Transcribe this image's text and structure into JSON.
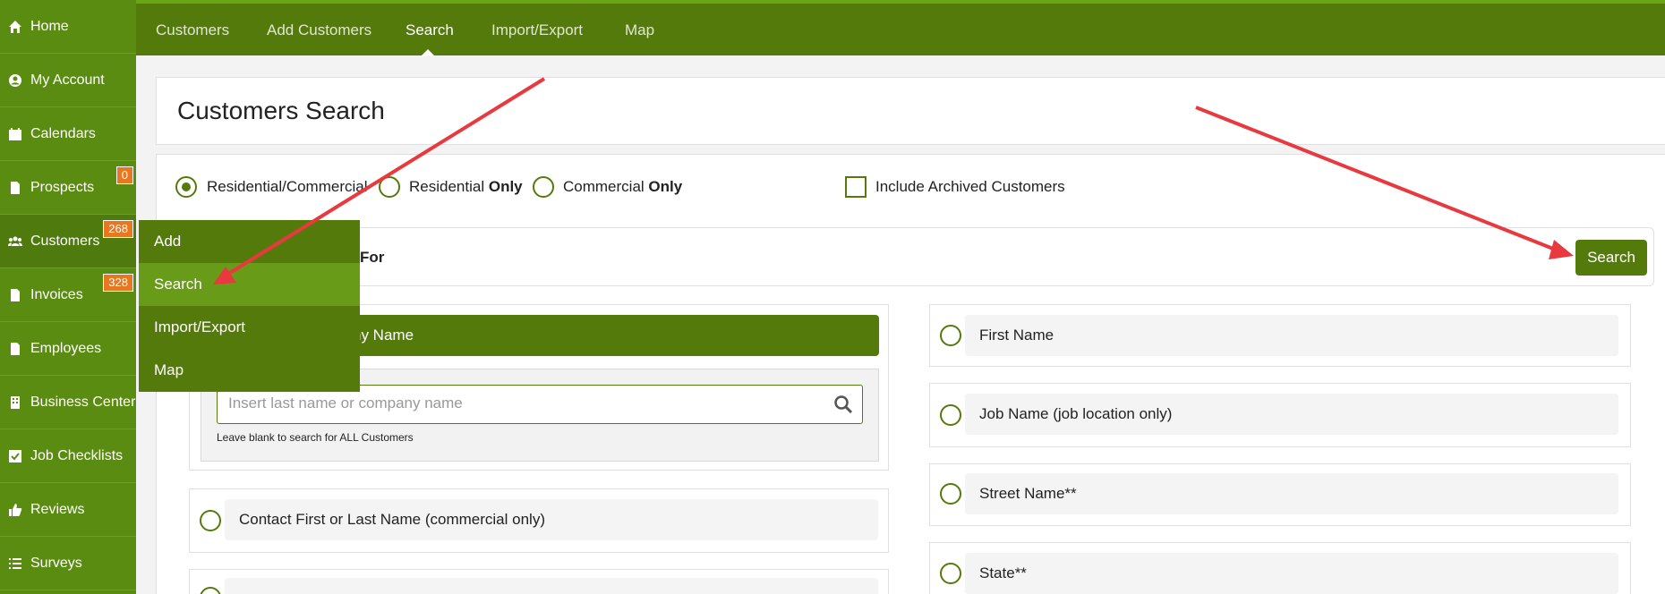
{
  "sidebar": {
    "items": [
      {
        "label": "Home",
        "icon": "home-icon"
      },
      {
        "label": "My Account",
        "icon": "user-circle-icon"
      },
      {
        "label": "Calendars",
        "icon": "calendar-icon"
      },
      {
        "label": "Prospects",
        "icon": "document-icon",
        "badge": "0"
      },
      {
        "label": "Customers",
        "icon": "users-icon",
        "badge": "268"
      },
      {
        "label": "Invoices",
        "icon": "document-icon",
        "badge": "328"
      },
      {
        "label": "Employees",
        "icon": "document-icon"
      },
      {
        "label": "Business Center",
        "icon": "building-icon"
      },
      {
        "label": "Job Checklists",
        "icon": "checkbox-icon"
      },
      {
        "label": "Reviews",
        "icon": "thumbs-up-icon"
      },
      {
        "label": "Surveys",
        "icon": "list-icon"
      }
    ]
  },
  "topnav": {
    "tabs": [
      "Customers",
      "Add Customers",
      "Search",
      "Import/Export",
      "Map"
    ],
    "active": "Search"
  },
  "page": {
    "title": "Customers Search"
  },
  "filters": {
    "residential_commercial": "Residential/Commercial",
    "residential": "Residential",
    "commercial": "Commercial",
    "only": "Only",
    "include_archived": "Include Archived Customers"
  },
  "search_for": {
    "label": "For",
    "button": "Search"
  },
  "fields": {
    "last_name_partial": "ny Name",
    "search_placeholder": "Insert last name or company name",
    "hint": "Leave blank to search for ALL Customers",
    "contact_name": "Contact First or Last Name (commercial only)",
    "first_name": "First Name",
    "job_name": "Job Name (job location only)",
    "street_name": "Street Name**",
    "state": "State**"
  },
  "dropdown": {
    "items": [
      "Add",
      "Search",
      "Import/Export",
      "Map"
    ],
    "active": "Search"
  },
  "colors": {
    "sidebar": "#5b8c12",
    "topnav": "#557a0c",
    "accent": "#557a0c",
    "badge": "#e87722",
    "annotation_arrow": "#e8393f"
  }
}
